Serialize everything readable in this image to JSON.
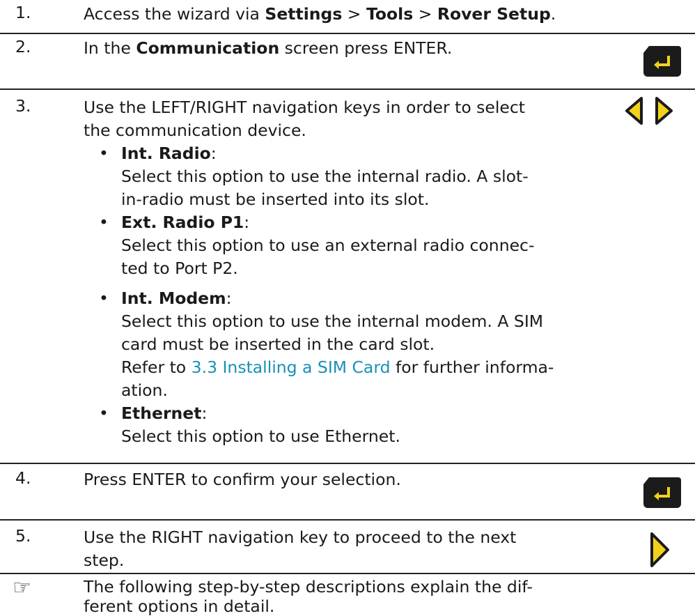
{
  "step1": {
    "num": "1.",
    "prefix": "Access the wizard via ",
    "path1": "Settings",
    "sep": " > ",
    "path2": "Tools",
    "path3": "Rover Setup",
    "suffix": "."
  },
  "step2": {
    "num": "2.",
    "prefix": "In the ",
    "bold": "Communication",
    "suffix": " screen press ENTER.",
    "key_icon": "enter-key-icon"
  },
  "step3": {
    "num": "3.",
    "line1": "Use the LEFT/RIGHT navigation keys in order to select",
    "line2": "the communication device.",
    "key_icons": [
      "left-arrow-key-icon",
      "right-arrow-key-icon"
    ],
    "bullet": "•",
    "options": [
      {
        "name": "Int. Radio",
        "colon": ":",
        "desc_lines": [
          "Select this option to use the internal radio. A slot-",
          "in-radio must be inserted into its slot."
        ]
      },
      {
        "name": "Ext. Radio P1",
        "colon": ":",
        "desc_lines": [
          "Select this option to use an external radio connec-",
          "ted to Port P2."
        ]
      },
      {
        "name": "Int. Modem",
        "colon": ":",
        "desc_lines": [
          "Select this option to use the internal modem. A SIM",
          "card must be inserted in the card slot."
        ],
        "refer_prefix": "Refer to ",
        "refer_link": "3.3 Installing a SIM Card",
        "refer_suffix": " for further informa-",
        "refer_cont": "ation."
      },
      {
        "name": "Ethernet",
        "colon": ":",
        "desc_lines": [
          "Select this option to use Ethernet."
        ]
      }
    ]
  },
  "step4": {
    "num": "4.",
    "text": "Press ENTER to confirm your selection.",
    "key_icon": "enter-key-icon"
  },
  "step5": {
    "num": "5.",
    "line1": "Use the RIGHT navigation key to proceed to the next",
    "line2": "step.",
    "key_icon": "right-arrow-key-icon"
  },
  "note": {
    "icon": "☞",
    "line1": "The following step-by-step descriptions explain the dif-",
    "line2": "ferent options in detail."
  },
  "colors": {
    "key_body": "#1b1b1b",
    "key_accent": "#f2d31b",
    "link": "#1a8fb8"
  }
}
